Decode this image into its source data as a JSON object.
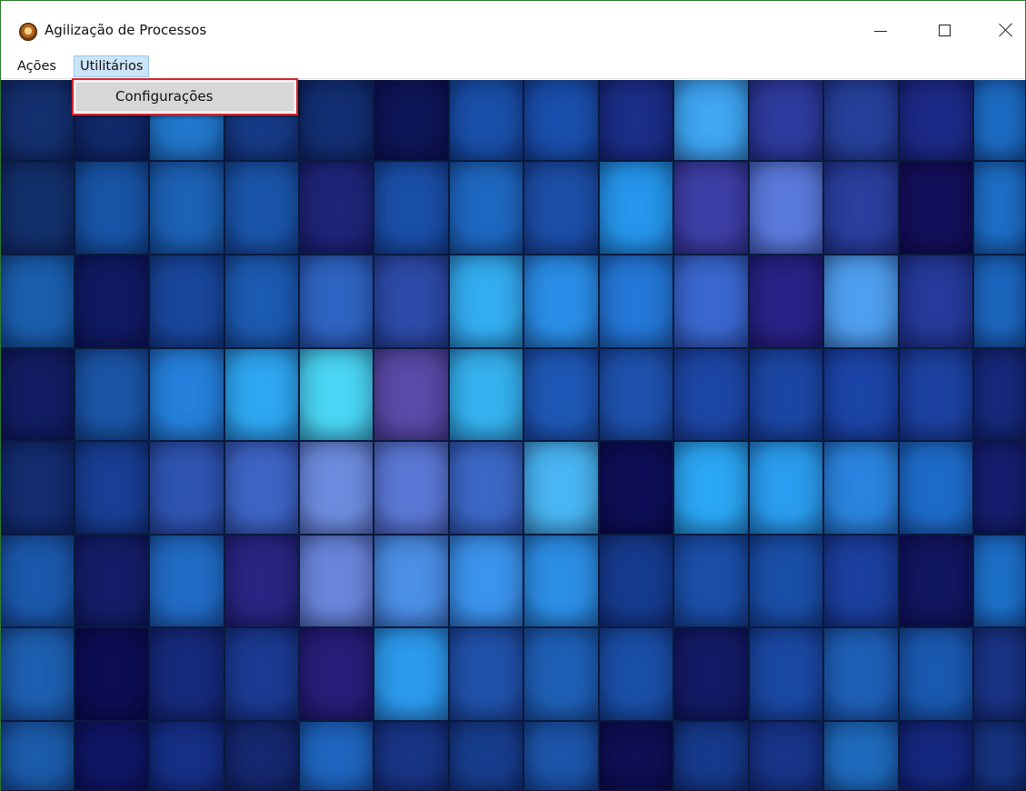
{
  "window": {
    "title": "Agilização de Processos"
  },
  "menubar": {
    "items": [
      {
        "label": "Ações"
      },
      {
        "label": "Utilitários"
      }
    ]
  },
  "dropdown": {
    "items": [
      {
        "label": "Configurações"
      }
    ]
  },
  "icons": {
    "app": "app-logo-icon",
    "minimize": "minimize-icon",
    "maximize": "maximize-icon",
    "close": "close-icon"
  },
  "colors": {
    "menu_highlight": "#cce4f7",
    "dropdown_outline": "#d9232d"
  },
  "tile_colors": [
    [
      "#14306f",
      "#102a6a",
      "#2178cc",
      "#163b86",
      "#122f73",
      "#0e1557",
      "#1950aa",
      "#1a4fad",
      "#1b2e88",
      "#3fa7f4",
      "#2f3b9e",
      "#26409b",
      "#1d2a88",
      "#1d6fc8"
    ],
    [
      "#13306c",
      "#1855a7",
      "#1c62b5",
      "#1a55aa",
      "#1e2578",
      "#1a4fa8",
      "#1e68c1",
      "#1c4fa8",
      "#2596ec",
      "#3e3fa6",
      "#5b7add",
      "#2a3f9e",
      "#140f5b",
      "#1d70c9"
    ],
    [
      "#1a5fae",
      "#101a63",
      "#19479c",
      "#1c5bb2",
      "#2f64c2",
      "#2d4ba8",
      "#33aef2",
      "#2a8ee8",
      "#2478d8",
      "#3a68d0",
      "#2a2287",
      "#4f9ff0",
      "#253a9a",
      "#1c68c2"
    ],
    [
      "#121d63",
      "#1a55a6",
      "#2581dc",
      "#2ea8f3",
      "#4ad7f5",
      "#5b4aa8",
      "#35b3f0",
      "#1e58b6",
      "#1e52ae",
      "#1d47a6",
      "#1b47a4",
      "#1c45a8",
      "#1c41a0",
      "#162a7d"
    ],
    [
      "#132d70",
      "#183f94",
      "#2f55b2",
      "#3e65c6",
      "#6e8de0",
      "#5b78d6",
      "#3b68c6",
      "#49b6f3",
      "#0e0e57",
      "#2ba8f5",
      "#2a9ef0",
      "#2a85e0",
      "#1e6cca",
      "#161f72"
    ],
    [
      "#1b59ac",
      "#141e68",
      "#216cc6",
      "#2a2583",
      "#6a86dc",
      "#4b8fe6",
      "#3b94ee",
      "#2c8fe6",
      "#163c8f",
      "#1b4fa8",
      "#1a4fa8",
      "#1b3f9e",
      "#111660",
      "#1d72cc"
    ],
    [
      "#1d5fb0",
      "#0d0d55",
      "#162a7c",
      "#1b3a92",
      "#261e78",
      "#2c9bef",
      "#2052ab",
      "#1e60b6",
      "#1a4fa8",
      "#131b66",
      "#1a49a4",
      "#1e60b8",
      "#1a59b0",
      "#1a3588"
    ],
    [
      "#1c5cac",
      "#101666",
      "#163088",
      "#152870",
      "#1e66c0",
      "#183586",
      "#173e8e",
      "#1c55aa",
      "#0f0f55",
      "#163a8c",
      "#18358a",
      "#1e6bbd",
      "#152880",
      "#163582"
    ]
  ]
}
